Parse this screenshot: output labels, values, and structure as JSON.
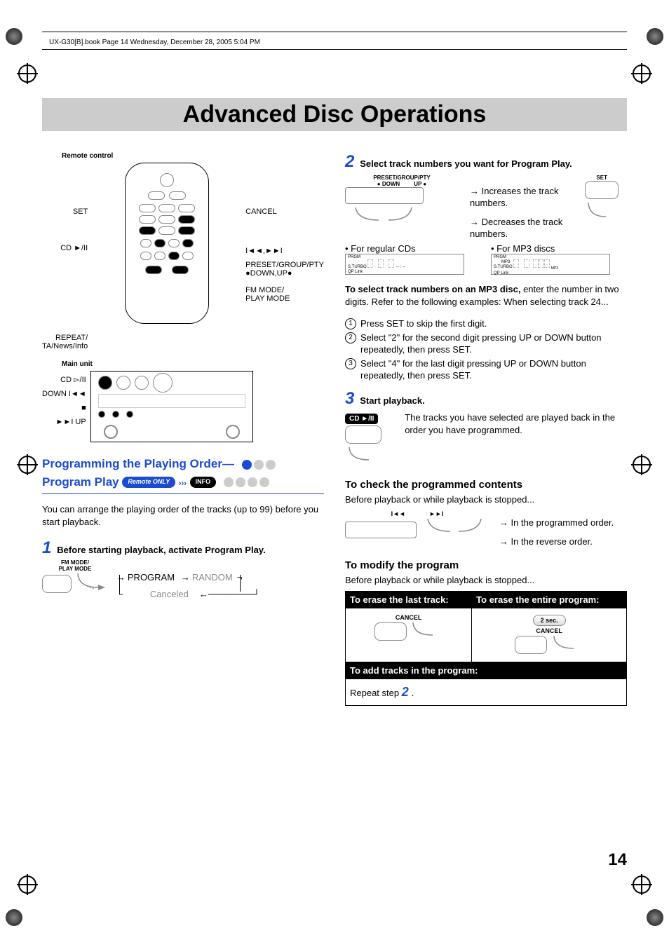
{
  "header": "UX-G30[B].book  Page 14  Wednesday, December 28, 2005  5:04 PM",
  "title": "Advanced Disc Operations",
  "page_number": "14",
  "left": {
    "remote_label": "Remote control",
    "main_unit_label": "Main unit",
    "remote_callouts": {
      "set": "SET",
      "cd_play": "CD ►/ΙΙ",
      "repeat": "REPEAT/",
      "repeat2": "TA/News/Info",
      "cancel": "CANCEL",
      "skip": "Ι◄◄,►►Ι",
      "preset": "PRESET/GROUP/PTY",
      "downup": "●DOWN,UP●",
      "fmmode": "FM MODE/",
      "playmode": "PLAY MODE"
    },
    "unit_callouts": {
      "cd": "CD ▻/ΙΙ",
      "down": "DOWN Ι◄◄",
      "stop": "■",
      "up": "►►Ι UP"
    },
    "section_heading_line1": "Programming the Playing Order—",
    "section_heading_line2": "Program Play",
    "pill_remote": "Remote ONLY",
    "pill_info": "INFO",
    "intro": "You can arrange the playing order of the tracks (up to 99) before you start playback.",
    "step1_num": "1",
    "step1_text": "Before starting playback, activate Program Play.",
    "fmmode_small1": "FM MODE/",
    "fmmode_small2": "PLAY MODE",
    "flow_program": "PROGRAM",
    "flow_random": "RANDOM",
    "flow_canceled": "Canceled"
  },
  "right": {
    "step2_num": "2",
    "step2_text": "Select track numbers you want for Program Play.",
    "preset_label": "PRESET/GROUP/PTY",
    "down_label": "DOWN",
    "up_label": "UP",
    "set_label": "SET",
    "inc_text": "Increases the track numbers.",
    "dec_text": "Decreases the track numbers.",
    "regular_cds": "• For regular CDs",
    "mp3_discs": "• For MP3 discs",
    "lcd_prgm": "PRGM",
    "lcd_sturbo": "S.TURBO",
    "lcd_qplink": "QP Link",
    "lcd_mp3": "MP3",
    "mp3_select_bold": "To select track numbers on an MP3 disc,",
    "mp3_select_rest": " enter the number in two digits. Refer to the following examples: When selecting track 24...",
    "li1": "Press SET to skip the first digit.",
    "li2": "Select \"2\" for the second digit pressing UP or DOWN button repeatedly, then press SET.",
    "li3": "Select \"4\" for the last digit pressing UP or DOWN button repeatedly, then press SET.",
    "step3_num": "3",
    "step3_text": "Start playback.",
    "cd_play_badge": "CD ►/ΙΙ",
    "step3_desc": "The tracks you have selected are played back in the order you have programmed.",
    "check_heading": "To check the programmed contents",
    "check_before": "Before playback or while playback is stopped...",
    "skip_prev": "Ι◄◄",
    "skip_next": "►►Ι",
    "in_prog_order": "In the programmed order.",
    "in_rev_order": "In the reverse order.",
    "modify_heading": "To modify the program",
    "modify_before": "Before playback or while playback is stopped...",
    "th_erase_last": "To erase the last track:",
    "th_erase_all": "To erase the entire program:",
    "cancel_label": "CANCEL",
    "two_sec": "2 sec.",
    "th_add": "To add tracks in the program:",
    "repeat_step": "Repeat step ",
    "repeat_step_num": "2",
    "repeat_step_dot": "."
  }
}
